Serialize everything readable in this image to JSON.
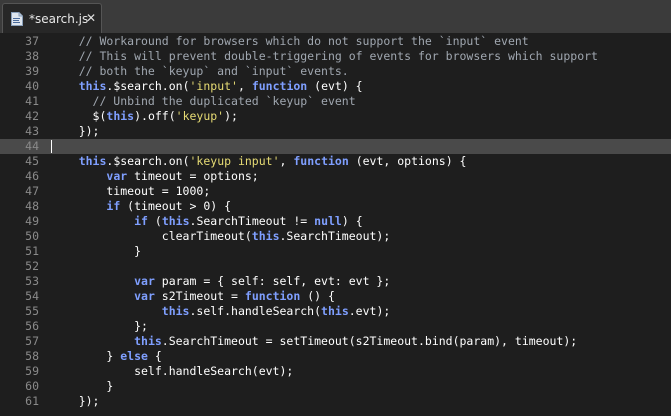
{
  "tab": {
    "title": "*search.js",
    "icon": "js-file-icon",
    "close_glyph": "✕"
  },
  "editor": {
    "current_line": 44,
    "colors": {
      "background": "#1e1e1e",
      "comment": "#a0a7b0",
      "keyword": "#7f9fff",
      "string": "#e6db74",
      "text": "#ffffff",
      "line_number": "#8a8a8a",
      "current_line": "#4a4a4a"
    },
    "lines": [
      {
        "n": 37,
        "tokens": [
          [
            "c",
            "    // Workaround for browsers which do not support the `input` event"
          ]
        ]
      },
      {
        "n": 38,
        "tokens": [
          [
            "c",
            "    // This will prevent double-triggering of events for browsers which support"
          ]
        ]
      },
      {
        "n": 39,
        "tokens": [
          [
            "c",
            "    // both the `keyup` and `input` events."
          ]
        ]
      },
      {
        "n": 40,
        "tokens": [
          [
            "p",
            "    "
          ],
          [
            "k",
            "this"
          ],
          [
            "p",
            ".$search.on("
          ],
          [
            "s",
            "'input'"
          ],
          [
            "p",
            ", "
          ],
          [
            "k",
            "function"
          ],
          [
            "p",
            " (evt) {"
          ]
        ]
      },
      {
        "n": 41,
        "tokens": [
          [
            "c",
            "      // Unbind the duplicated `keyup` event"
          ]
        ]
      },
      {
        "n": 42,
        "tokens": [
          [
            "p",
            "      $("
          ],
          [
            "k",
            "this"
          ],
          [
            "p",
            ").off("
          ],
          [
            "s",
            "'keyup'"
          ],
          [
            "p",
            ");"
          ]
        ]
      },
      {
        "n": 43,
        "tokens": [
          [
            "p",
            "    });"
          ]
        ]
      },
      {
        "n": 44,
        "tokens": []
      },
      {
        "n": 45,
        "tokens": [
          [
            "p",
            "    "
          ],
          [
            "k",
            "this"
          ],
          [
            "p",
            ".$search.on("
          ],
          [
            "s",
            "'keyup input'"
          ],
          [
            "p",
            ", "
          ],
          [
            "k",
            "function"
          ],
          [
            "p",
            " (evt, options) {"
          ]
        ]
      },
      {
        "n": 46,
        "tokens": [
          [
            "p",
            "        "
          ],
          [
            "k",
            "var"
          ],
          [
            "p",
            " timeout = options;"
          ]
        ]
      },
      {
        "n": 47,
        "tokens": [
          [
            "p",
            "        timeout = 1000;"
          ]
        ]
      },
      {
        "n": 48,
        "tokens": [
          [
            "p",
            "        "
          ],
          [
            "k",
            "if"
          ],
          [
            "p",
            " (timeout > 0) {"
          ]
        ]
      },
      {
        "n": 49,
        "tokens": [
          [
            "p",
            "            "
          ],
          [
            "k",
            "if"
          ],
          [
            "p",
            " ("
          ],
          [
            "k",
            "this"
          ],
          [
            "p",
            ".SearchTimeout != "
          ],
          [
            "k",
            "null"
          ],
          [
            "p",
            ") {"
          ]
        ]
      },
      {
        "n": 50,
        "tokens": [
          [
            "p",
            "                clearTimeout("
          ],
          [
            "k",
            "this"
          ],
          [
            "p",
            ".SearchTimeout);"
          ]
        ]
      },
      {
        "n": 51,
        "tokens": [
          [
            "p",
            "            }"
          ]
        ]
      },
      {
        "n": 52,
        "tokens": []
      },
      {
        "n": 53,
        "tokens": [
          [
            "p",
            "            "
          ],
          [
            "k",
            "var"
          ],
          [
            "p",
            " param = { self: self, evt: evt };"
          ]
        ]
      },
      {
        "n": 54,
        "tokens": [
          [
            "p",
            "            "
          ],
          [
            "k",
            "var"
          ],
          [
            "p",
            " s2Timeout = "
          ],
          [
            "k",
            "function"
          ],
          [
            "p",
            " () {"
          ]
        ]
      },
      {
        "n": 55,
        "tokens": [
          [
            "p",
            "                "
          ],
          [
            "k",
            "this"
          ],
          [
            "p",
            ".self.handleSearch("
          ],
          [
            "k",
            "this"
          ],
          [
            "p",
            ".evt);"
          ]
        ]
      },
      {
        "n": 56,
        "tokens": [
          [
            "p",
            "            };"
          ]
        ]
      },
      {
        "n": 57,
        "tokens": [
          [
            "p",
            "            "
          ],
          [
            "k",
            "this"
          ],
          [
            "p",
            ".SearchTimeout = setTimeout(s2Timeout.bind(param), timeout);"
          ]
        ]
      },
      {
        "n": 58,
        "tokens": [
          [
            "p",
            "        } "
          ],
          [
            "k",
            "else"
          ],
          [
            "p",
            " {"
          ]
        ]
      },
      {
        "n": 59,
        "tokens": [
          [
            "p",
            "            self.handleSearch(evt);"
          ]
        ]
      },
      {
        "n": 60,
        "tokens": [
          [
            "p",
            "        }"
          ]
        ]
      },
      {
        "n": 61,
        "tokens": [
          [
            "p",
            "    });"
          ]
        ]
      }
    ]
  }
}
